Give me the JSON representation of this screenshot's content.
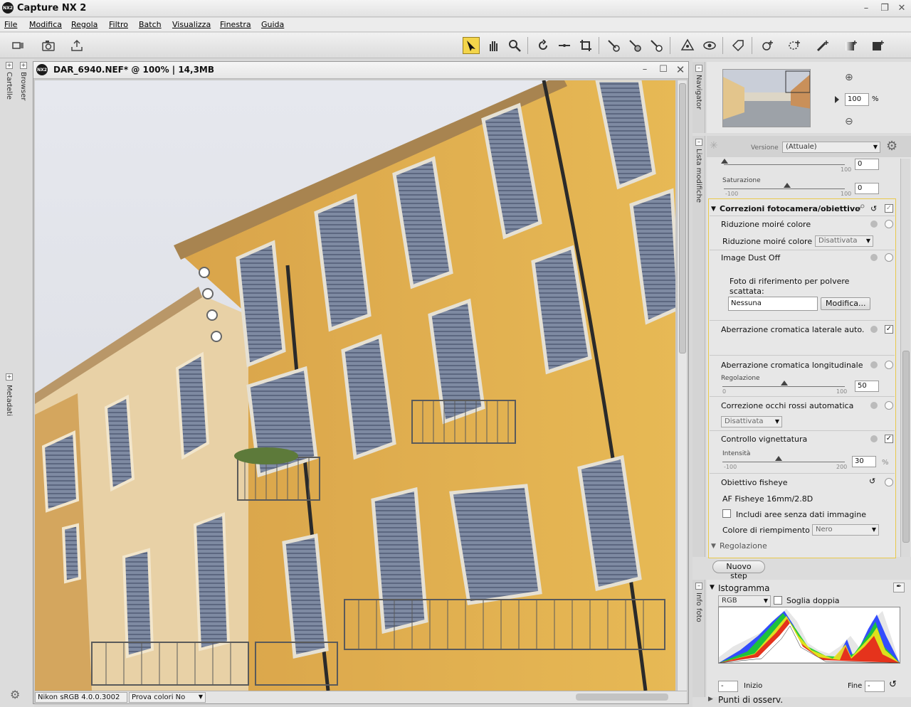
{
  "app": {
    "title": "Capture NX 2",
    "logo": "NX2"
  },
  "menu": [
    "File",
    "Modifica",
    "Regola",
    "Filtro",
    "Batch",
    "Visualizza",
    "Finestra",
    "Guida"
  ],
  "left_panel": {
    "tab_top": "Cartelle",
    "tab_browser": "Browser",
    "tab_bottom": "Metadati"
  },
  "image_window": {
    "title": "DAR_6940.NEF* @ 100% | 14,3MB",
    "status_profile": "Nikon sRGB 4.0.0.3002",
    "status_softproof": "Prova colori No"
  },
  "navigator": {
    "tab": "Navigator",
    "zoom": "100",
    "zoom_unit": "%"
  },
  "edit_list": {
    "tab": "Lista modifiche",
    "version_label": "Versione",
    "version_value": "(Attuale)",
    "top_slider_max": "100",
    "top_slider_value": "0",
    "saturation_label": "Saturazione",
    "saturation_min": "-100",
    "saturation_max": "100",
    "saturation_value": "0",
    "section_title": "Correzioni fotocamera/obiettivo",
    "moire_title": "Riduzione moiré colore",
    "moire_label": "Riduzione moiré colore",
    "moire_value": "Disattivata",
    "dust_title": "Image Dust Off",
    "dust_desc": "Foto di riferimento per polvere scattata:",
    "dust_input": "Nessuna",
    "dust_button": "Modifica...",
    "lateral_ca": "Aberrazione cromatica laterale auto.",
    "longitudinal_ca": "Aberrazione cromatica longitudinale",
    "regolazione_label": "Regolazione",
    "reg_min": "0",
    "reg_max": "100",
    "reg_value": "50",
    "redeye_title": "Correzione occhi rossi automatica",
    "redeye_value": "Disattivata",
    "vignette_title": "Controllo vignettatura",
    "intensity_label": "Intensità",
    "int_min": "-100",
    "int_max": "200",
    "int_value": "30",
    "int_unit": "%",
    "fisheye_title": "Obiettivo fisheye",
    "fisheye_lens": "AF Fisheye 16mm/2.8D",
    "include_label": "Includi aree senza dati immagine",
    "fill_label": "Colore di riempimento",
    "fill_value": "Nero",
    "regolazione_section": "Regolazione",
    "new_step": "Nuovo step"
  },
  "histogram": {
    "tab": "Info foto",
    "title": "Istogramma",
    "channel": "RGB",
    "double_threshold": "Soglia doppia",
    "start_label": "Inizio",
    "end_label": "Fine",
    "start_value": "-",
    "end_value": "-"
  },
  "watchpoints": {
    "title": "Punti di osserv."
  },
  "colors": {
    "accent": "#f3d54a",
    "section_border": "#e9c94a",
    "wall": "#e3b24f"
  }
}
